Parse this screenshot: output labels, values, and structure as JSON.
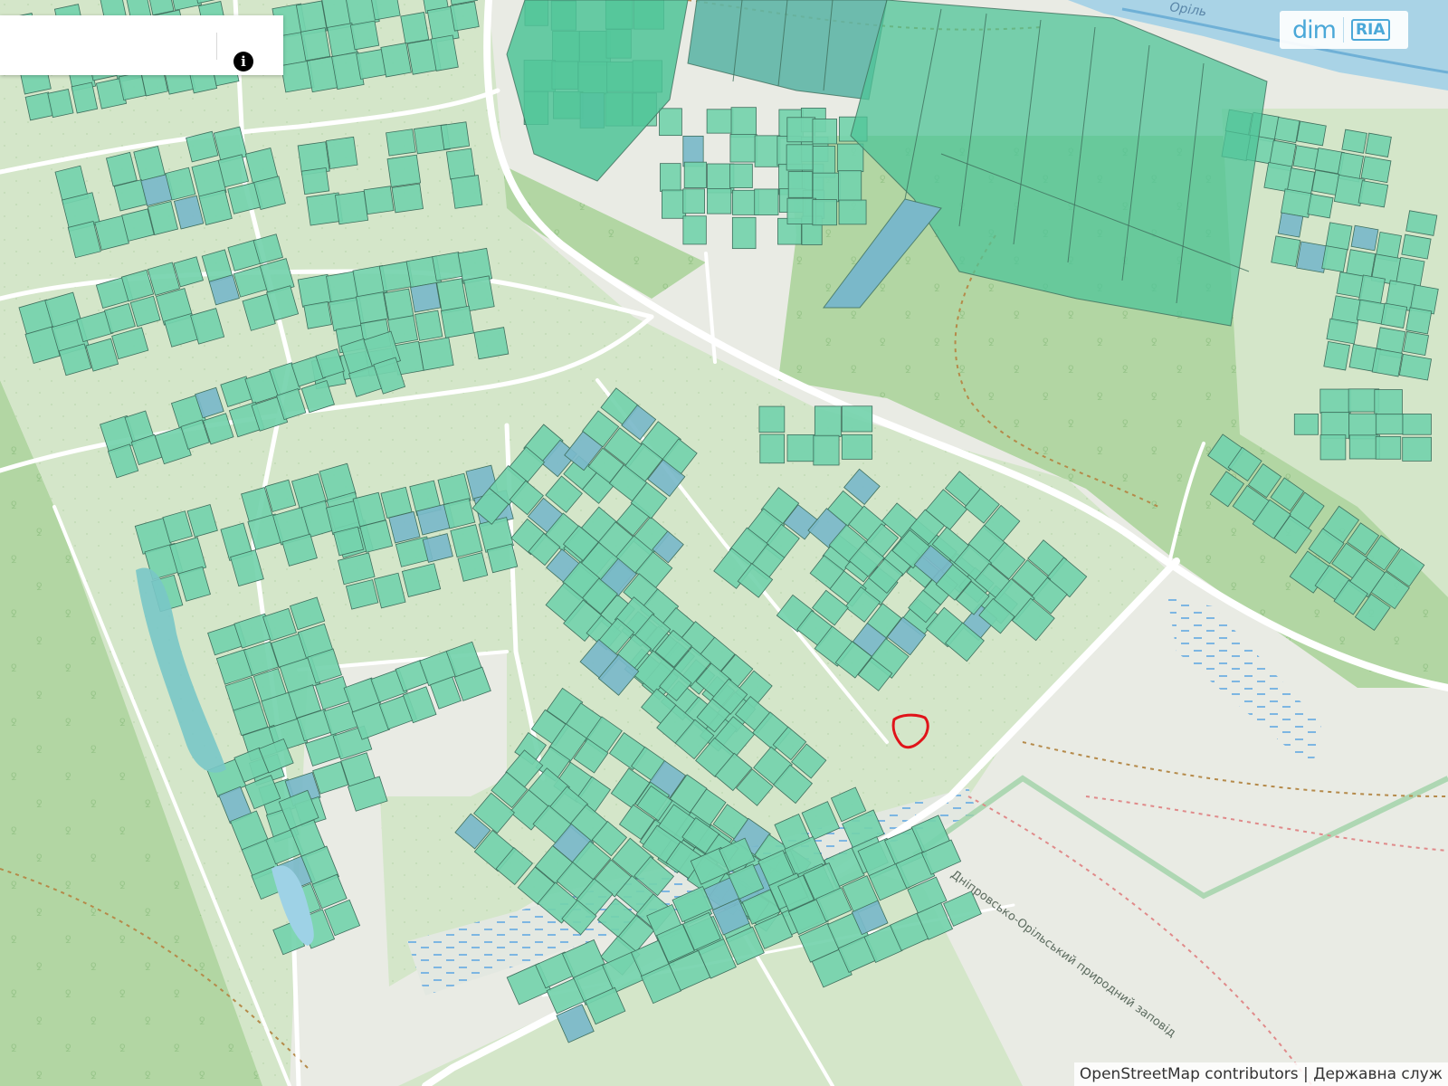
{
  "search": {
    "value": "",
    "placeholder": ""
  },
  "info_button": {
    "glyph": "i",
    "icon": "info-icon"
  },
  "logo": {
    "main": "dim",
    "sub": "RIA"
  },
  "attribution": {
    "osm": "OpenStreetMap contributors",
    "separator": "|",
    "agency": "Державна служ"
  },
  "labels": {
    "river": "Оріль",
    "reserve": "Дніпровсько-Орільський природний заповід"
  },
  "colors": {
    "background": "#e9ebe4",
    "forest": "#b2d6a3",
    "residential": "#d4e6c9",
    "parcel_fill": "#74d3ad",
    "parcel_fill_large": "#4fc498",
    "parcel_special": "#7ab8c9",
    "parcel_stroke": "#3f6f5d",
    "river": "#a9d3e6",
    "road": "#ffffff",
    "path": "#b58a4a",
    "boundary": "#e08a8a",
    "marker": "#e0141a"
  },
  "map": {
    "selected_plot": "highlighted plot outline (red)"
  }
}
